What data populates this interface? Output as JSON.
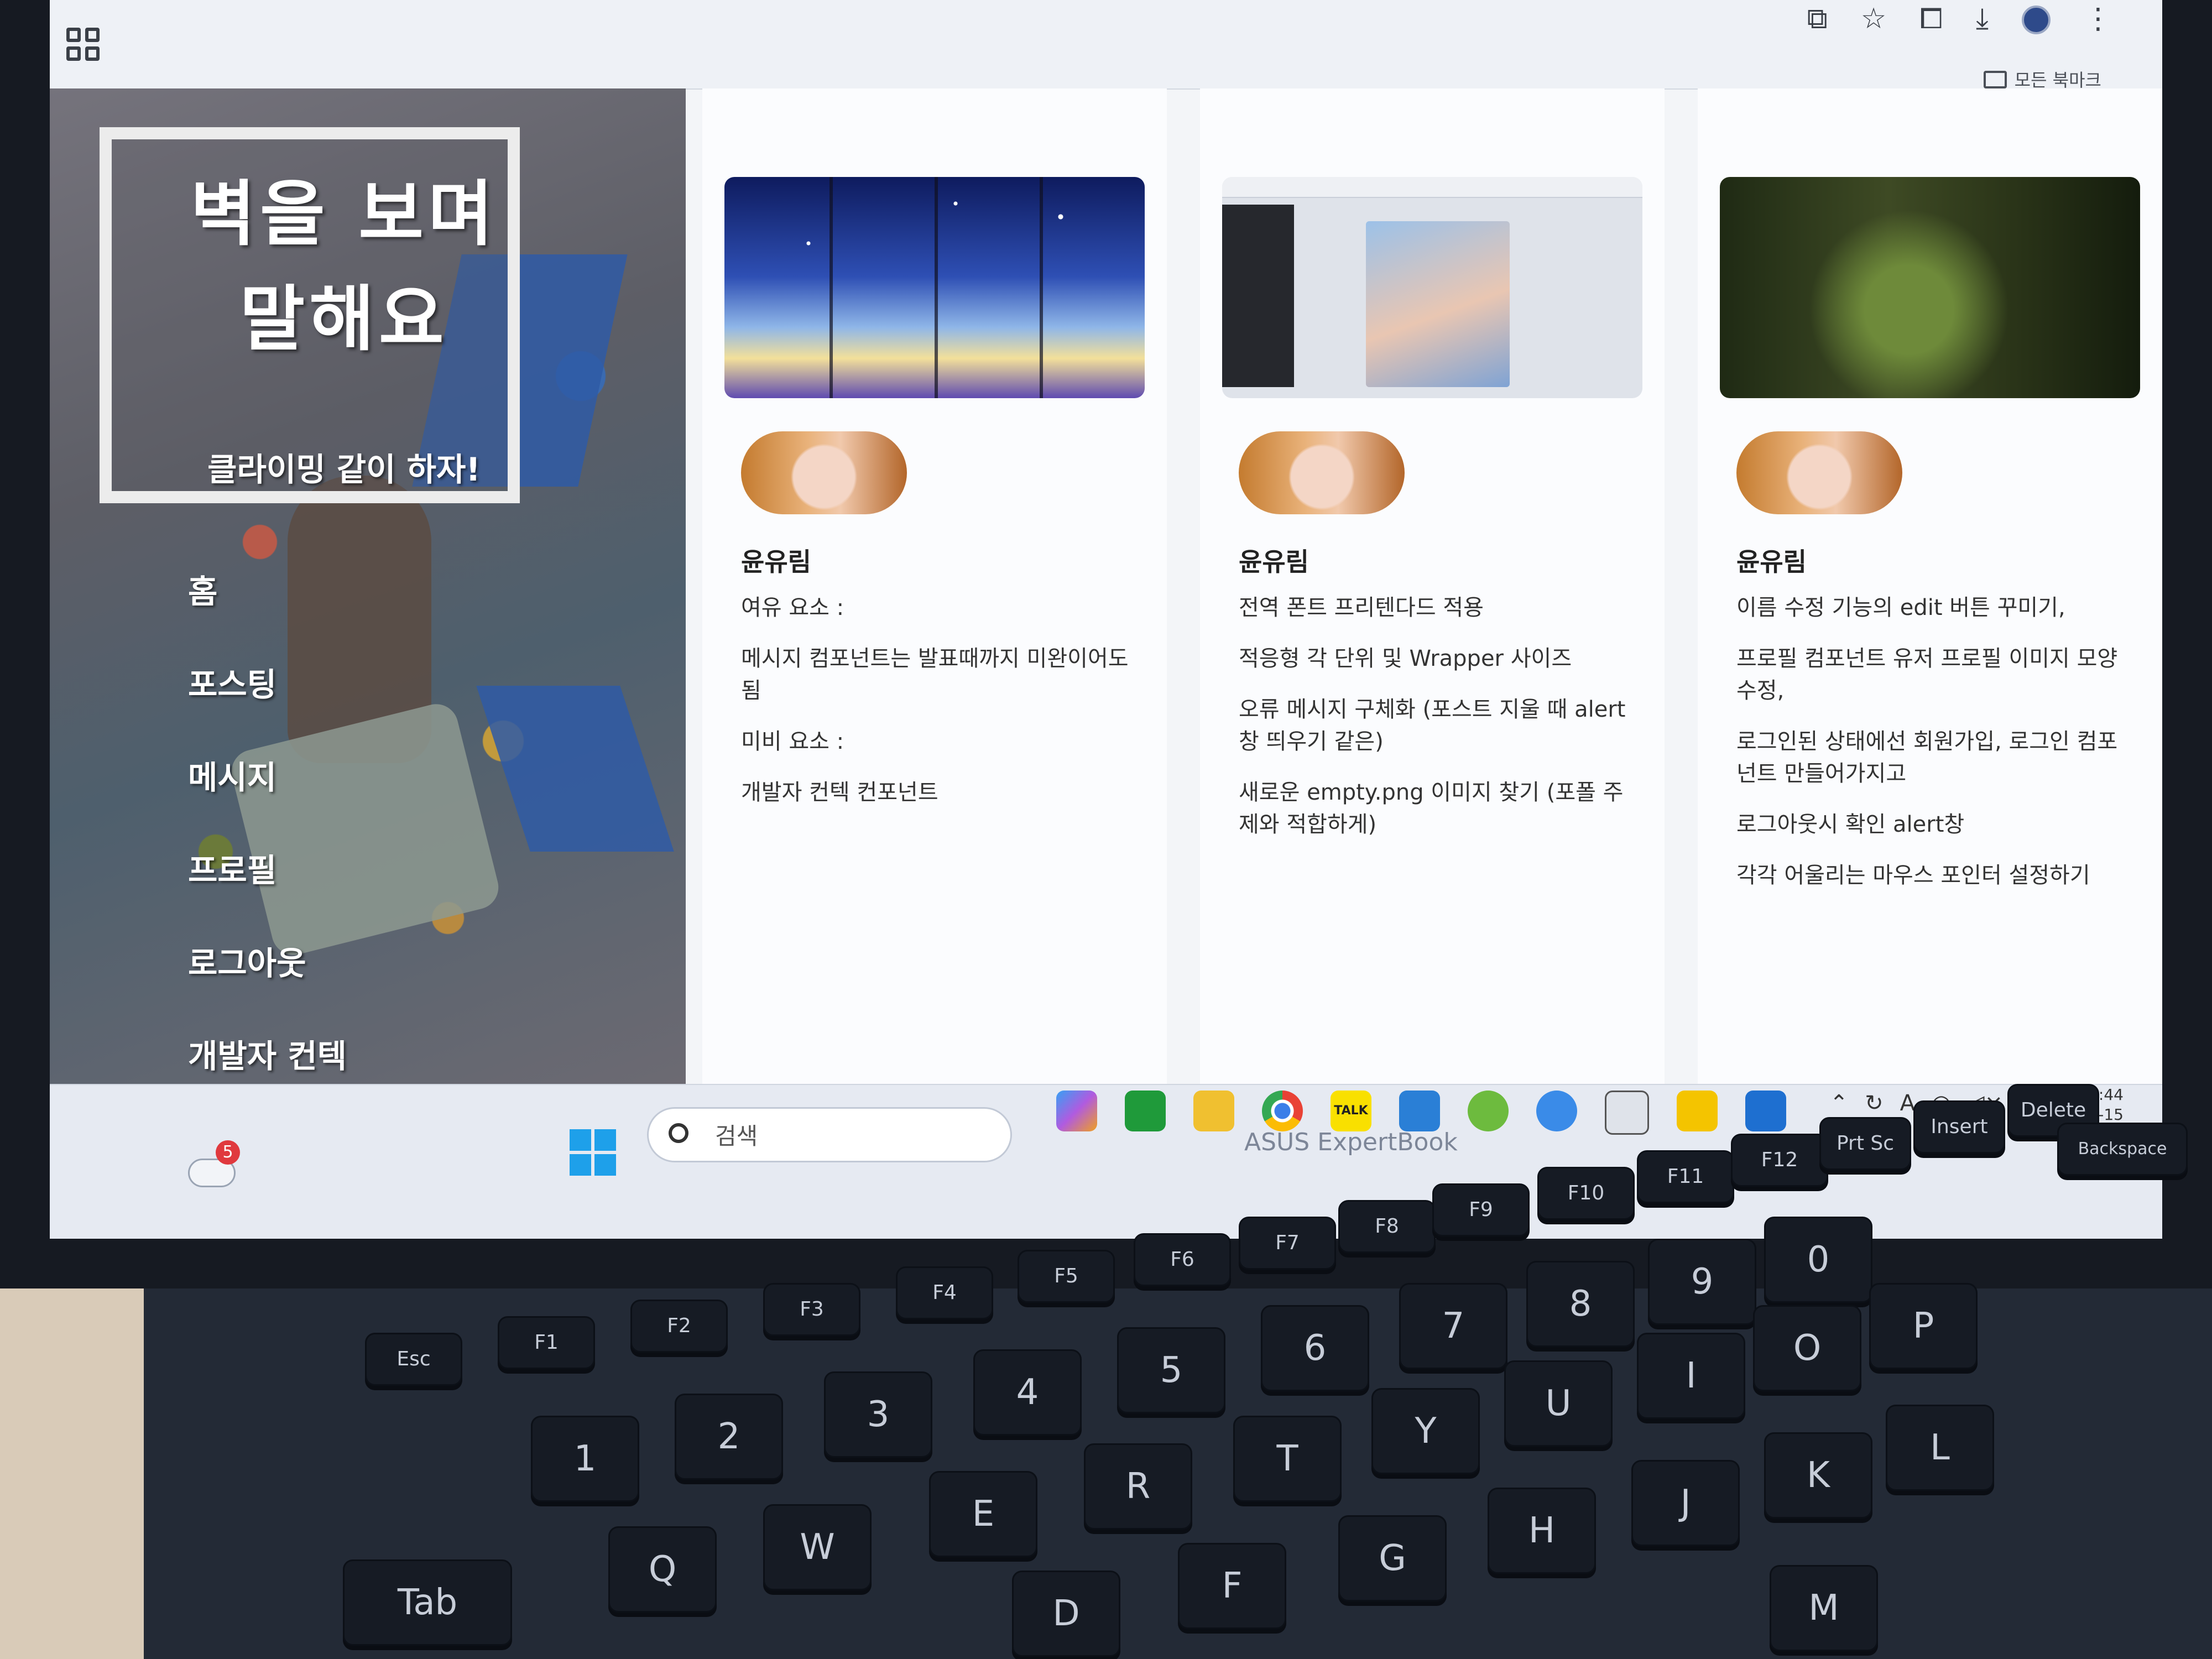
{
  "browser": {
    "bookmarks_label": "모든 북마크"
  },
  "sidebar": {
    "title": "벽을 보며 말해요",
    "subtitle": "클라이밍 같이 하자!",
    "nav": [
      "홈",
      "포스팅",
      "메시지",
      "프로필",
      "로그아웃",
      "개발자 컨텍"
    ]
  },
  "cards": [
    {
      "author": "윤유림",
      "notes": [
        "여유 요소 :",
        "메시지 컴포넌트는 발표때까지 미완이어도 됨",
        "미비 요소 :",
        "개발자 컨텍 컨포넌트"
      ]
    },
    {
      "author": "윤유림",
      "notes": [
        "전역 폰트 프리텐다드 적용",
        "적응형 각 단위 및 Wrapper 사이즈",
        "오류 메시지 구체화 (포스트 지울 때 alert창 띄우기 같은)",
        "새로운 empty.png 이미지 찾기 (포폴 주제와 적합하게)"
      ]
    },
    {
      "author": "윤유림",
      "notes": [
        "이름 수정 기능의 edit 버튼 꾸미기,",
        "프로필 컴포넌트 유저 프로필 이미지 모양 수정,",
        "로그인된 상태에선 회원가입, 로그인 컴포넌트 만들어가지고",
        "로그아웃시 확인 alert창",
        "각각 어울리는 마우스 포인터 설정하기"
      ]
    }
  ],
  "taskbar": {
    "search_placeholder": "검색",
    "weather_badge": "5",
    "app_talk_label": "TALK",
    "clock_time": "오후 6:44",
    "clock_date": "2024-11-15",
    "tray_ime": "A"
  },
  "laptop": {
    "brand": "ASUS ExpertBook",
    "keys": [
      "Esc",
      "F1",
      "F2",
      "F3",
      "F4",
      "F5",
      "F6",
      "F7",
      "F8",
      "F9",
      "F10",
      "F11",
      "F12",
      "Prt Sc",
      "Insert",
      "Delete",
      "1",
      "2",
      "3",
      "4",
      "5",
      "6",
      "7",
      "8",
      "9",
      "0",
      "Q",
      "W",
      "E",
      "R",
      "T",
      "Y",
      "U",
      "I",
      "O",
      "P",
      "Tab",
      "D",
      "F",
      "G",
      "H",
      "J",
      "K",
      "L",
      "M",
      "Backspace"
    ]
  }
}
